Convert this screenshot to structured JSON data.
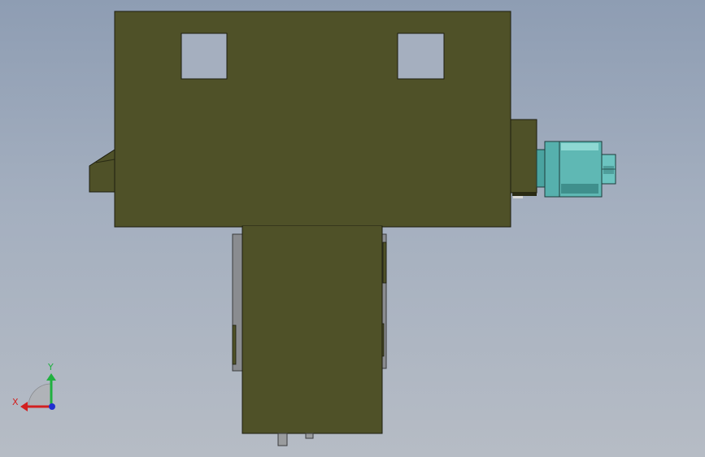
{
  "viewport": {
    "background_top": "#8e9db3",
    "background_bottom": "#b6bcc5"
  },
  "model": {
    "body_color": "#4f5128",
    "edge_color": "#1c1d0f",
    "motor_color": "#5fb8b4",
    "bracket_color": "#8a8c90"
  },
  "triad": {
    "x_label": "X",
    "y_label": "Y",
    "x_color": "#d22020",
    "y_color": "#20b040",
    "z_color": "#2030d0",
    "x_icon": "x-axis-arrow-icon",
    "y_icon": "y-axis-arrow-icon",
    "z_icon": "z-axis-dot-icon"
  }
}
